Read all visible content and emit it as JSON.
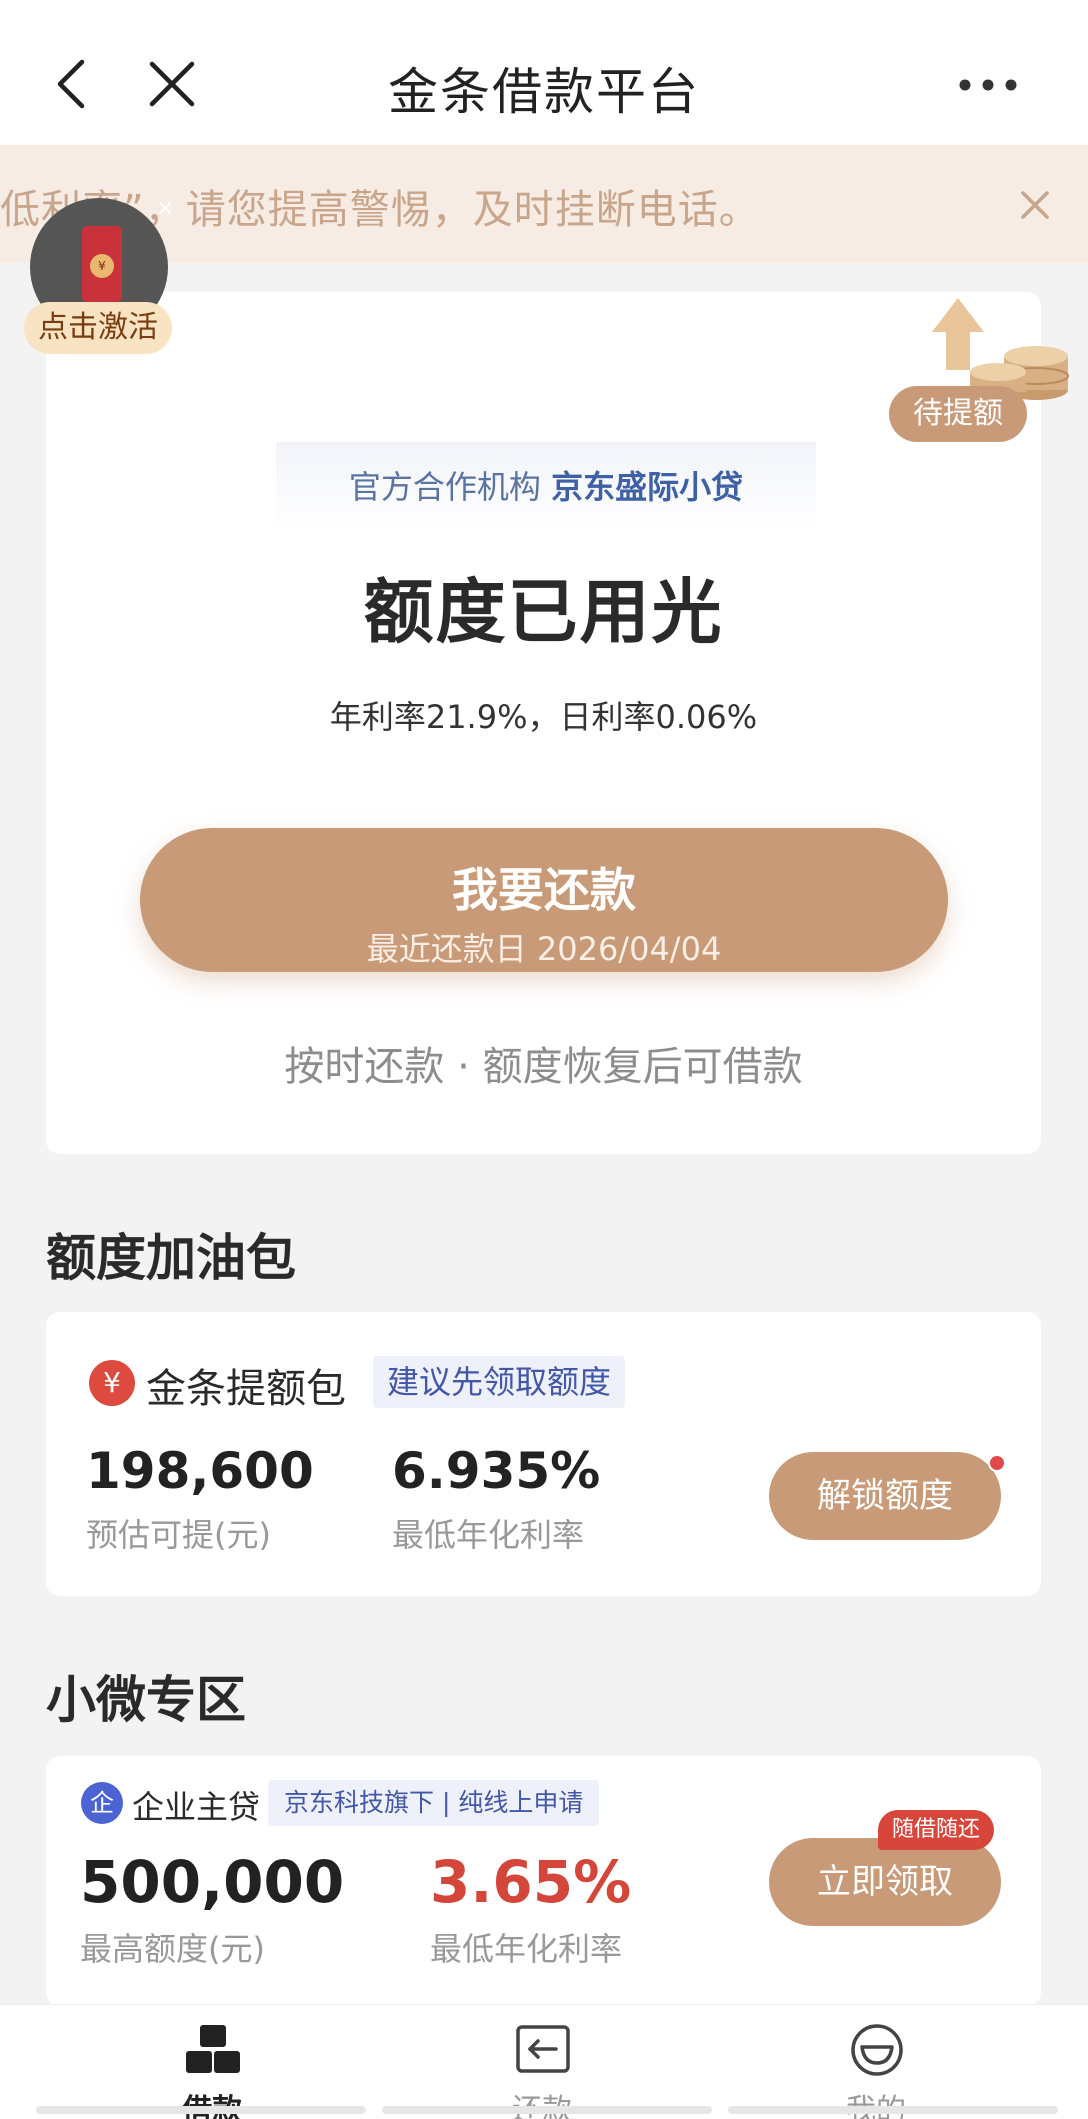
{
  "header": {
    "title": "金条借款平台"
  },
  "notice": {
    "text": "低利率”，请您提高警惕，及时挂断电话。"
  },
  "float_pack": {
    "label": "点击激活",
    "coin": "¥"
  },
  "main": {
    "badge": "待提额",
    "org_prefix": "官方合作机构",
    "org_name": "京东盛际小贷",
    "status": "额度已用光",
    "rate": "年利率21.9%，日利率0.06%",
    "repay_button": "我要还款",
    "repay_date": "最近还款日 2026/04/04",
    "hint": "按时还款 · 额度恢复后可借款"
  },
  "boost_section": {
    "title": "额度加油包",
    "icon_char": "¥",
    "name": "金条提额包",
    "tag": "建议先领取额度",
    "amount": "198,600",
    "amount_label": "预估可提(元)",
    "rate": "6.935%",
    "rate_label": "最低年化利率",
    "button": "解锁额度"
  },
  "micro_section": {
    "title": "小微专区",
    "icon_char": "企",
    "name": "企业主贷",
    "tag": "京东科技旗下 | 纯线上申请",
    "amount": "500,000",
    "amount_label": "最高额度(元)",
    "rate": "3.65%",
    "rate_label": "最低年化利率",
    "pill": "随借随还",
    "button": "立即领取"
  },
  "bottom_nav": [
    {
      "label": "借款",
      "icon": "blocks-icon",
      "active": true
    },
    {
      "label": "还款",
      "icon": "return-icon",
      "active": false
    },
    {
      "label": "我的",
      "icon": "smile-icon",
      "active": false
    }
  ],
  "colors": {
    "accent": "#c89a78",
    "red": "#d4463a",
    "link_blue": "#4257a8"
  }
}
